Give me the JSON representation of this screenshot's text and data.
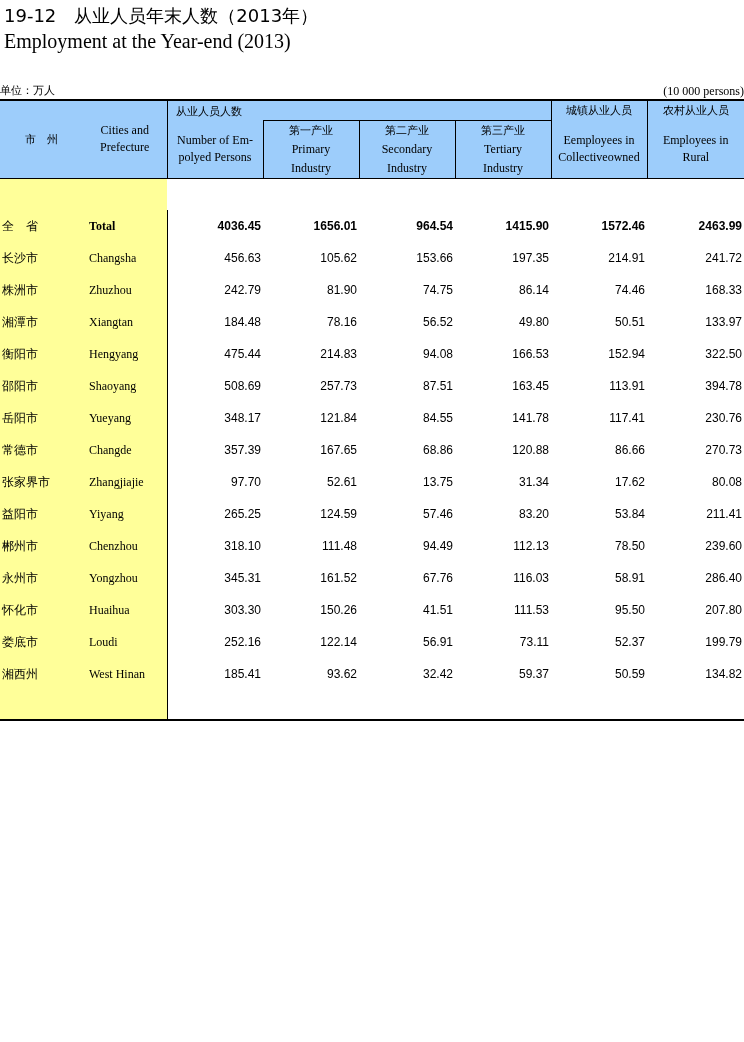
{
  "title": "19-12　从业人员年末人数（2013年）",
  "subtitle": "Employment at the Year-end (2013)",
  "unit_left": "单位：万人",
  "unit_right": "(10 000 persons)",
  "header": {
    "region_cn": "市　州",
    "region_en": [
      "Cities and",
      "Prefecture"
    ],
    "group_cn": "从业人员人数",
    "total_en": [
      "Number of  Em-",
      "polyed Persons"
    ],
    "sectors": [
      {
        "cn": "第一产业",
        "en": [
          "Primary",
          "Industry"
        ]
      },
      {
        "cn": "第二产业",
        "en": [
          "Secondary",
          "Industry"
        ]
      },
      {
        "cn": "第三产业",
        "en": [
          "Tertiary",
          "Industry"
        ]
      }
    ],
    "urban_cn": "城镇从业人员",
    "urban_en": [
      "Eemployees in",
      "Collectiveowned"
    ],
    "rural_cn": "农村从业人员",
    "rural_en": [
      "Employees in",
      "Rural"
    ]
  },
  "rows": [
    {
      "kind": "total",
      "cn": "全　省",
      "en": "Total",
      "values": [
        "4036.45",
        "1656.01",
        "964.54",
        "1415.90",
        "1572.46",
        "2463.99"
      ]
    },
    {
      "kind": "city",
      "cn": "长沙市",
      "en": "Changsha",
      "values": [
        "456.63",
        "105.62",
        "153.66",
        "197.35",
        "214.91",
        "241.72"
      ]
    },
    {
      "kind": "city",
      "cn": "株洲市",
      "en": "Zhuzhou",
      "values": [
        "242.79",
        "81.90",
        "74.75",
        "86.14",
        "74.46",
        "168.33"
      ]
    },
    {
      "kind": "city",
      "cn": "湘潭市",
      "en": "Xiangtan",
      "values": [
        "184.48",
        "78.16",
        "56.52",
        "49.80",
        "50.51",
        "133.97"
      ]
    },
    {
      "kind": "city",
      "cn": "衡阳市",
      "en": "Hengyang",
      "values": [
        "475.44",
        "214.83",
        "94.08",
        "166.53",
        "152.94",
        "322.50"
      ]
    },
    {
      "kind": "city",
      "cn": "邵阳市",
      "en": "Shaoyang",
      "values": [
        "508.69",
        "257.73",
        "87.51",
        "163.45",
        "113.91",
        "394.78"
      ]
    },
    {
      "kind": "city",
      "cn": "岳阳市",
      "en": "Yueyang",
      "values": [
        "348.17",
        "121.84",
        "84.55",
        "141.78",
        "117.41",
        "230.76"
      ]
    },
    {
      "kind": "city",
      "cn": "常德市",
      "en": "Changde",
      "values": [
        "357.39",
        "167.65",
        "68.86",
        "120.88",
        "86.66",
        "270.73"
      ]
    },
    {
      "kind": "city",
      "cn": "张家界市",
      "en": "Zhangjiajie",
      "values": [
        "97.70",
        "52.61",
        "13.75",
        "31.34",
        "17.62",
        "80.08"
      ]
    },
    {
      "kind": "city",
      "cn": "益阳市",
      "en": "Yiyang",
      "values": [
        "265.25",
        "124.59",
        "57.46",
        "83.20",
        "53.84",
        "211.41"
      ]
    },
    {
      "kind": "city",
      "cn": "郴州市",
      "en": "Chenzhou",
      "values": [
        "318.10",
        "111.48",
        "94.49",
        "112.13",
        "78.50",
        "239.60"
      ]
    },
    {
      "kind": "city",
      "cn": "永州市",
      "en": "Yongzhou",
      "values": [
        "345.31",
        "161.52",
        "67.76",
        "116.03",
        "58.91",
        "286.40"
      ]
    },
    {
      "kind": "city",
      "cn": "怀化市",
      "en": "Huaihua",
      "values": [
        "303.30",
        "150.26",
        "41.51",
        "111.53",
        "95.50",
        "207.80"
      ]
    },
    {
      "kind": "city",
      "cn": "娄底市",
      "en": "Loudi",
      "values": [
        "252.16",
        "122.14",
        "56.91",
        "73.11",
        "52.37",
        "199.79"
      ]
    },
    {
      "kind": "city",
      "cn": "湘西州",
      "en": "West Hinan",
      "values": [
        "185.41",
        "93.62",
        "32.42",
        "59.37",
        "50.59",
        "134.82"
      ]
    }
  ]
}
